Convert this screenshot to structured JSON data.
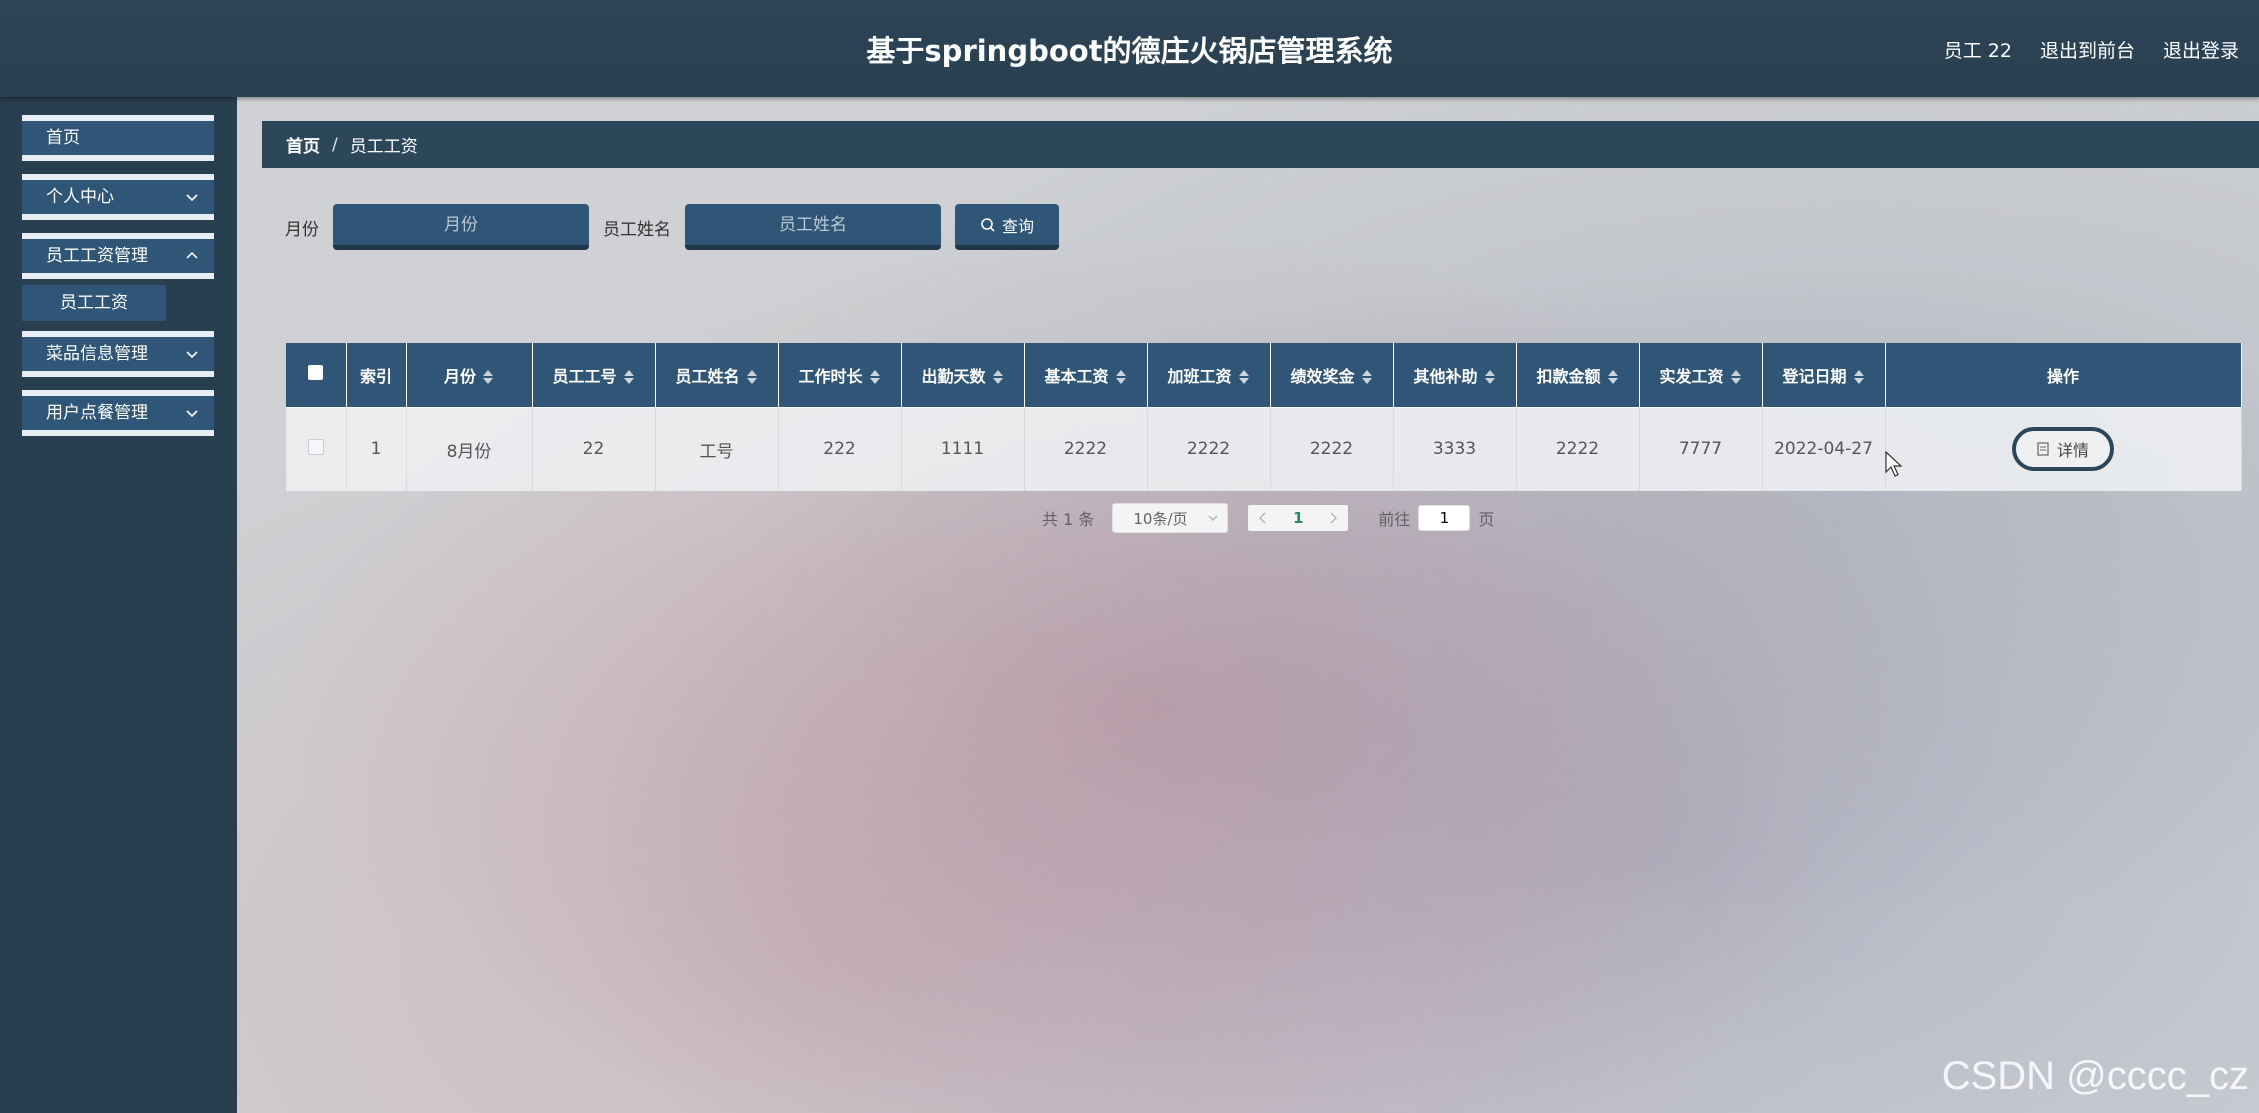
{
  "header": {
    "title": "基于springboot的德庄火锅店管理系统",
    "user": "员工 22",
    "back_to_front": "退出到前台",
    "logout": "退出登录"
  },
  "sidebar": {
    "items": [
      {
        "label": "首页"
      },
      {
        "label": "个人中心"
      },
      {
        "label": "员工工资管理"
      },
      {
        "label": "菜品信息管理"
      },
      {
        "label": "用户点餐管理"
      }
    ],
    "subitem": {
      "label": "员工工资"
    }
  },
  "breadcrumb": {
    "home": "首页",
    "separator": "/",
    "current": "员工工资"
  },
  "search": {
    "month_label": "月份",
    "month_placeholder": "月份",
    "name_label": "员工姓名",
    "name_placeholder": "员工姓名",
    "query_button": "查询"
  },
  "table": {
    "columns": [
      "索引",
      "月份",
      "员工工号",
      "员工姓名",
      "工作时长",
      "出勤天数",
      "基本工资",
      "加班工资",
      "绩效奖金",
      "其他补助",
      "扣款金额",
      "实发工资",
      "登记日期",
      "操作"
    ],
    "rows": [
      [
        "1",
        "8月份",
        "22",
        "工号",
        "222",
        "1111",
        "2222",
        "2222",
        "2222",
        "3333",
        "2222",
        "7777",
        "2022-04-27"
      ]
    ],
    "detail_button": "详情"
  },
  "pagination": {
    "total": "共 1 条",
    "page_size": "10条/页",
    "current_page": "1",
    "goto_prefix": "前往",
    "goto_value": "1",
    "goto_suffix": "页"
  },
  "watermark": "CSDN @cccc_cz",
  "colors": {
    "sidebar": "#283f50",
    "header": "#2c4457",
    "accent": "#2f5676",
    "page_active": "#1e8a6e"
  }
}
